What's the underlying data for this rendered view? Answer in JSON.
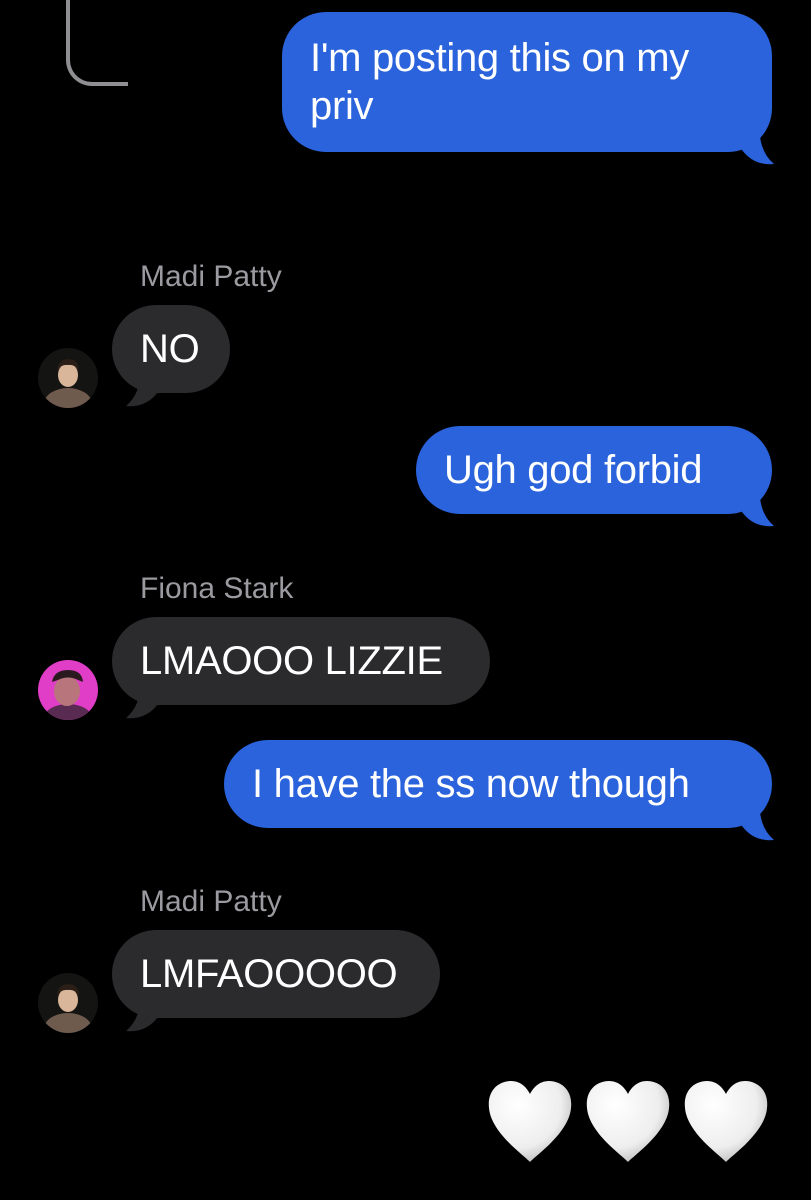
{
  "conversation": {
    "messages": [
      {
        "type": "sent",
        "text_lines": [
          "I'm posting this on my",
          "priv"
        ]
      },
      {
        "type": "received",
        "sender": "Madi Patty",
        "text": "NO"
      },
      {
        "type": "sent",
        "text": "Ugh god forbid"
      },
      {
        "type": "received",
        "sender": "Fiona Stark",
        "text": "LMAOOO LIZZIE"
      },
      {
        "type": "sent",
        "text": "I have the ss now though"
      },
      {
        "type": "received",
        "sender": "Madi Patty",
        "text": "LMFAOOOOO"
      }
    ],
    "reactions": {
      "icon": "white-heart-icon",
      "count": 3
    }
  },
  "colors": {
    "background": "#000000",
    "sent_bubble": "#2a63db",
    "received_bubble": "#2b2b2d",
    "sender_name": "#9a9aa0",
    "text": "#ffffff"
  }
}
